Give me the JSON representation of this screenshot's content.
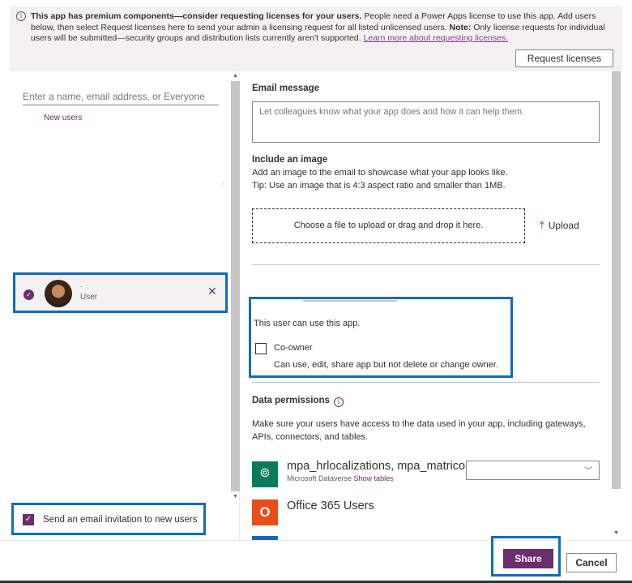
{
  "banner": {
    "bold_text": "This app has premium components—consider requesting licenses for your users.",
    "text_1": " People need a Power Apps license to use this app. Add users below, then select Request licenses here to send your admin a licensing request for all listed unlicensed users. ",
    "note_label": "Note:",
    "text_2": " Only license requests for individual users will be submitted—security groups and distribution lists currently aren't supported. ",
    "link": "Learn more about requesting licenses.",
    "request_button": "Request licenses",
    "info_icon": "i"
  },
  "left": {
    "search_placeholder": "Enter a name, email address, or Everyone",
    "new_users": "New users",
    "user": {
      "name": ".",
      "role": "User"
    },
    "send_email_label": "Send an email invitation to new users"
  },
  "right": {
    "email_title": "Email message",
    "email_placeholder": "Let colleagues know what your app does and how it can help them.",
    "image_title": "Include an image",
    "image_desc": "Add an image to the email to showcase what your app looks like.",
    "image_tip": "Tip: Use an image that is 4:3 aspect ratio and smaller than 1MB.",
    "dropzone": "Choose a file to upload or drag and drop it here.",
    "upload": "Upload",
    "permission_text": "This user can use this app.",
    "coowner_label": "Co-owner",
    "coowner_desc": "Can use, edit, share app but not delete or change owner.",
    "data_perm_title": "Data permissions",
    "data_perm_desc_1": "Make sure your users have access to the data used in your app, including gateways,",
    "data_perm_desc_2": "APIs, connectors, and tables.",
    "connectors": [
      {
        "name": "mpa_hrlocalizations, mpa_matricol",
        "source": "Microsoft Dataverse",
        "link": "Show tables"
      },
      {
        "name": "Office 365 Users"
      }
    ]
  },
  "footer": {
    "share": "Share",
    "cancel": "Cancel"
  },
  "colors": {
    "accent": "#6b2d6b",
    "highlight": "#0f6cbd"
  }
}
